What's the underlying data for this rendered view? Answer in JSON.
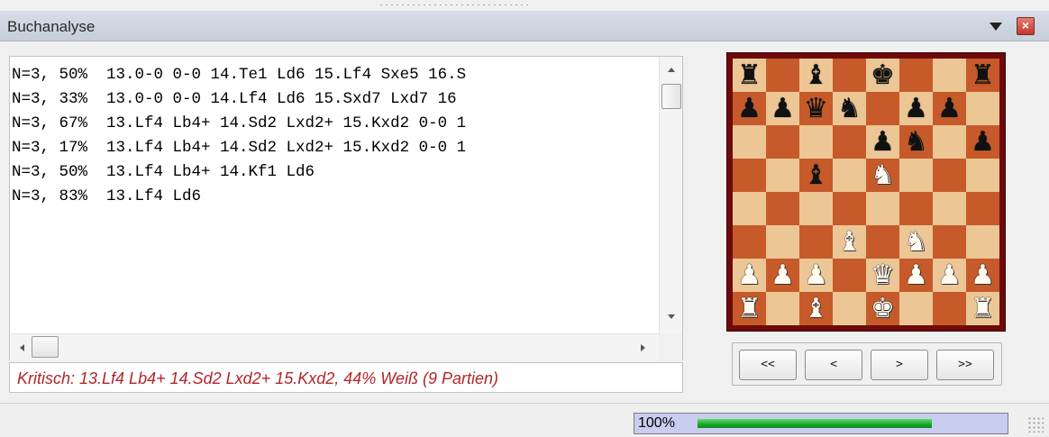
{
  "panel": {
    "title": "Buchanalyse"
  },
  "book_lines": [
    "N=3, 50%  13.0-0 0-0 14.Te1 Ld6 15.Lf4 Sxe5 16.S",
    "N=3, 33%  13.0-0 0-0 14.Lf4 Ld6 15.Sxd7 Lxd7 16",
    "N=3, 67%  13.Lf4 Lb4+ 14.Sd2 Lxd2+ 15.Kxd2 0-0 1",
    "N=3, 17%  13.Lf4 Lb4+ 14.Sd2 Lxd2+ 15.Kxd2 0-0 1",
    "N=3, 50%  13.Lf4 Lb4+ 14.Kf1 Ld6",
    "N=3, 83%  13.Lf4 Ld6"
  ],
  "critical_line": "Kritisch:  13.Lf4 Lb4+ 14.Sd2 Lxd2+ 15.Kxd2,  44% Weiß (9 Partien)",
  "board": {
    "light_color": "#ecc695",
    "dark_color": "#c75a2a",
    "ranks": [
      [
        "r",
        "",
        "b",
        "",
        "k",
        "",
        "",
        "r"
      ],
      [
        "p",
        "p",
        "q",
        "n",
        "",
        "p",
        "p",
        ""
      ],
      [
        "",
        "",
        "",
        "",
        "p",
        "n",
        "",
        "p"
      ],
      [
        "",
        "",
        "b",
        "",
        "N",
        "",
        "",
        ""
      ],
      [
        "",
        "",
        "",
        "",
        "",
        "",
        "",
        ""
      ],
      [
        "",
        "",
        "",
        "B",
        "",
        "N",
        "",
        ""
      ],
      [
        "P",
        "P",
        "P",
        "",
        "Q",
        "P",
        "P",
        "P"
      ],
      [
        "R",
        "",
        "B",
        "",
        "K",
        "",
        "",
        "R"
      ]
    ]
  },
  "navigation": {
    "first_label": "<<",
    "prev_label": "<",
    "next_label": ">",
    "last_label": ">>"
  },
  "status": {
    "progress_label": "100%",
    "progress_fraction": 1.0,
    "progress_color": "#1aa62c"
  },
  "icons": {
    "dropdown": "triangle-down-icon",
    "close": "close-icon"
  }
}
